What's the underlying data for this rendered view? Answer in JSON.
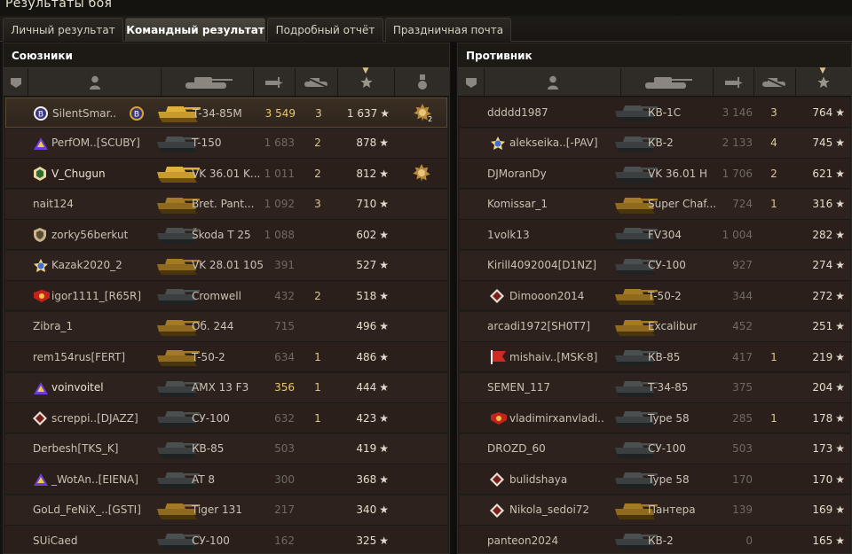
{
  "window_title": "Результаты боя",
  "tabs": [
    {
      "label": "Личный результат",
      "active": false
    },
    {
      "label": "Командный результат",
      "active": true
    },
    {
      "label": "Подробный отчёт",
      "active": false
    },
    {
      "label": "Праздничная почта",
      "active": false
    }
  ],
  "allies": {
    "title": "Союзники",
    "rows": [
      {
        "player": "SilentSmar..",
        "tank": "T-34-85M",
        "damage": "3 549",
        "kills": "3",
        "xp": "1 637",
        "badge": "purple-circle",
        "tank_color": "gold",
        "self": true,
        "damage_hl": true,
        "medal": "2"
      },
      {
        "player": "PerfOM..[SCUBY]",
        "tank": "T-150",
        "damage": "1 683",
        "kills": "2",
        "xp": "878",
        "badge": "purple",
        "tank_color": "dark"
      },
      {
        "player": "V_Chugun",
        "tank": "VK 36.01 K...",
        "damage": "1 011",
        "kills": "2",
        "xp": "812",
        "badge": "green",
        "tank_color": "gold",
        "squad": true,
        "medal": ""
      },
      {
        "player": "nait124",
        "tank": "Bret. Pant...",
        "damage": "1 092",
        "kills": "3",
        "xp": "710",
        "badge": "",
        "tank_color": "gold-dim"
      },
      {
        "player": "zorky56berkut",
        "tank": "Škoda T 25",
        "damage": "1 088",
        "kills": "",
        "xp": "602",
        "badge": "shield",
        "tank_color": "dark"
      },
      {
        "player": "Kazak2020_2",
        "tank": "VK 28.01 105",
        "damage": "391",
        "kills": "",
        "xp": "527",
        "badge": "blue-star",
        "tank_color": "gold-dim"
      },
      {
        "player": "igor1111_[R65R]",
        "tank": "Cromwell",
        "damage": "432",
        "kills": "2",
        "xp": "518",
        "badge": "red",
        "tank_color": "dark"
      },
      {
        "player": "Zibra_1",
        "tank": "Об. 244",
        "damage": "715",
        "kills": "",
        "xp": "496",
        "badge": "",
        "tank_color": "gold-dim"
      },
      {
        "player": "rem154rus[FERT]",
        "tank": "T-50-2",
        "damage": "634",
        "kills": "1",
        "xp": "486",
        "badge": "",
        "tank_color": "gold-dim"
      },
      {
        "player": "voinvoitel",
        "tank": "AMX 13 F3",
        "damage": "356",
        "kills": "1",
        "xp": "444",
        "badge": "purple",
        "tank_color": "dark",
        "squad": true,
        "damage_hl": true
      },
      {
        "player": "screppi..[DJAZZ]",
        "tank": "СУ-100",
        "damage": "632",
        "kills": "1",
        "xp": "423",
        "badge": "diamond",
        "tank_color": "dark"
      },
      {
        "player": "Derbesh[TKS_K]",
        "tank": "КВ-85",
        "damage": "503",
        "kills": "",
        "xp": "419",
        "badge": "",
        "tank_color": "dark"
      },
      {
        "player": "_WotAn..[EIENA]",
        "tank": "AT 8",
        "damage": "300",
        "kills": "",
        "xp": "368",
        "badge": "purple",
        "tank_color": "dark"
      },
      {
        "player": "GoLd_FeNiX_..[GSTI]",
        "tank": "Tiger 131",
        "damage": "217",
        "kills": "",
        "xp": "340",
        "badge": "",
        "tank_color": "gold-dim"
      },
      {
        "player": "SUiCaed",
        "tank": "СУ-100",
        "damage": "162",
        "kills": "",
        "xp": "325",
        "badge": "",
        "tank_color": "dark"
      }
    ]
  },
  "enemies": {
    "title": "Противник",
    "rows": [
      {
        "player": "ddddd1987",
        "tank": "КВ-1С",
        "damage": "3 146",
        "kills": "3",
        "xp": "764",
        "badge": "",
        "tank_color": "dark"
      },
      {
        "player": "alekseika..[-PAV]",
        "tank": "КВ-2",
        "damage": "2 133",
        "kills": "4",
        "xp": "745",
        "badge": "blue-star",
        "tank_color": "dark"
      },
      {
        "player": "DJMoranDy",
        "tank": "VK 36.01 H",
        "damage": "1 706",
        "kills": "2",
        "xp": "621",
        "badge": "",
        "tank_color": "dark"
      },
      {
        "player": "Komissar_1",
        "tank": "Super Chaf...",
        "damage": "724",
        "kills": "1",
        "xp": "316",
        "badge": "",
        "tank_color": "gold-dim"
      },
      {
        "player": "1volk13",
        "tank": "FV304",
        "damage": "1 004",
        "kills": "",
        "xp": "282",
        "badge": "",
        "tank_color": "dark"
      },
      {
        "player": "Kirill4092004[D1NZ]",
        "tank": "СУ-100",
        "damage": "927",
        "kills": "",
        "xp": "274",
        "badge": "",
        "tank_color": "dark"
      },
      {
        "player": "Dimooon2014",
        "tank": "T-50-2",
        "damage": "344",
        "kills": "",
        "xp": "272",
        "badge": "diamond",
        "tank_color": "gold-dim"
      },
      {
        "player": "arcadi1972[SH0T7]",
        "tank": "Excalibur",
        "damage": "452",
        "kills": "",
        "xp": "251",
        "badge": "",
        "tank_color": "gold-dim"
      },
      {
        "player": "mishaiv..[MSK-8]",
        "tank": "КВ-85",
        "damage": "417",
        "kills": "1",
        "xp": "219",
        "badge": "red-flag",
        "tank_color": "dark"
      },
      {
        "player": "SEMEN_117",
        "tank": "T-34-85",
        "damage": "375",
        "kills": "",
        "xp": "204",
        "badge": "",
        "tank_color": "dark"
      },
      {
        "player": "vladimirxanvladi..",
        "tank": "Type 58",
        "damage": "285",
        "kills": "1",
        "xp": "178",
        "badge": "red",
        "tank_color": "dark"
      },
      {
        "player": "DROZD_60",
        "tank": "СУ-100",
        "damage": "503",
        "kills": "",
        "xp": "173",
        "badge": "",
        "tank_color": "dark"
      },
      {
        "player": "bulidshaya",
        "tank": "Type 58",
        "damage": "170",
        "kills": "",
        "xp": "170",
        "badge": "diamond",
        "tank_color": "dark"
      },
      {
        "player": "Nikola_sedoi72",
        "tank": "Пантера",
        "damage": "139",
        "kills": "",
        "xp": "169",
        "badge": "diamond",
        "tank_color": "gold-dim"
      },
      {
        "player": "panteon2024",
        "tank": "КВ-2",
        "damage": "0",
        "kills": "",
        "xp": "165",
        "badge": "",
        "tank_color": "dark"
      }
    ]
  },
  "colors": {
    "accent_gold": "#e8c66a",
    "background": "#211e1a",
    "row": "#2a1f1b"
  },
  "icons": {
    "star": "★"
  }
}
